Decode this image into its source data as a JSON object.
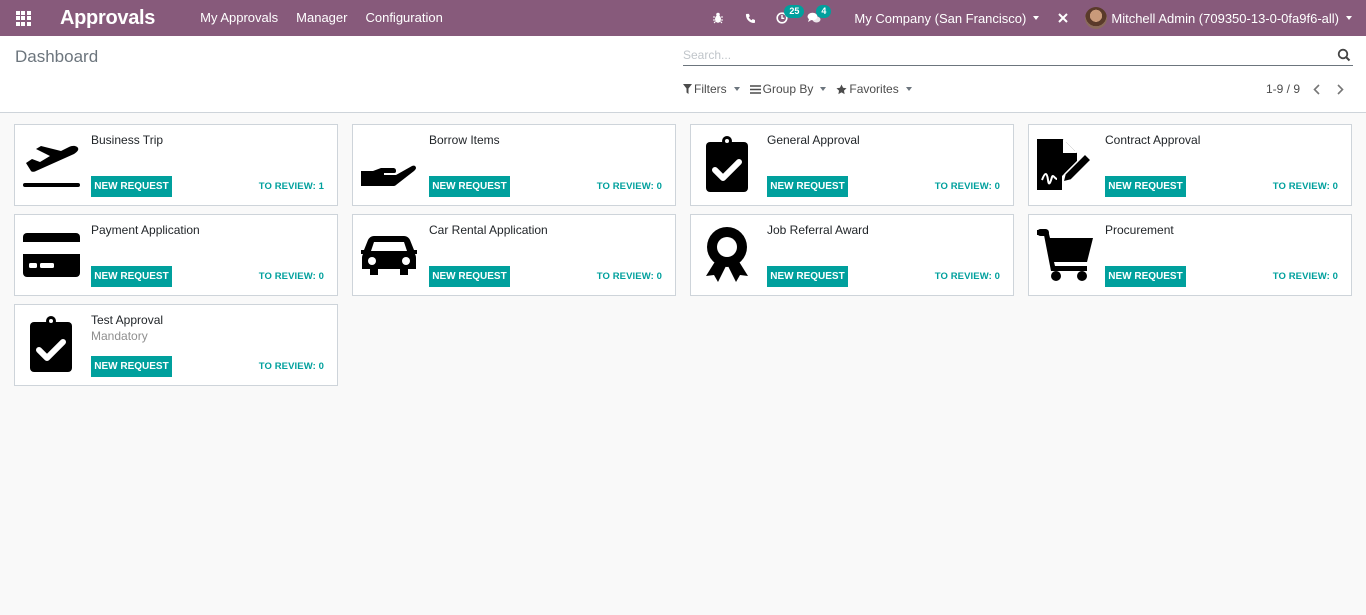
{
  "navbar": {
    "app_title": "Approvals",
    "menu": [
      "My Approvals",
      "Manager",
      "Configuration"
    ],
    "activity_count": "25",
    "message_count": "4",
    "company": "My Company (San Francisco)",
    "user": "Mitchell Admin (709350-13-0-0fa9f6-all)",
    "icons": [
      "apps-icon",
      "bug-icon",
      "phone-icon",
      "clock-icon",
      "chat-icon",
      "tools-icon"
    ],
    "color": "#875a7b"
  },
  "control_panel": {
    "breadcrumb": "Dashboard",
    "search_placeholder": "Search...",
    "filters_label": "Filters",
    "groupby_label": "Group By",
    "favorites_label": "Favorites",
    "pager": "1-9 / 9"
  },
  "accent_color": "#00a09d",
  "cards": [
    {
      "title": "Business Trip",
      "subtitle": "",
      "icon": "plane-departure-icon",
      "button": "NEW REQUEST",
      "review": "TO REVIEW: 1"
    },
    {
      "title": "Borrow Items",
      "subtitle": "",
      "icon": "hand-icon",
      "button": "NEW REQUEST",
      "review": "TO REVIEW: 0"
    },
    {
      "title": "General Approval",
      "subtitle": "",
      "icon": "clipboard-check-icon",
      "button": "NEW REQUEST",
      "review": "TO REVIEW: 0"
    },
    {
      "title": "Contract Approval",
      "subtitle": "",
      "icon": "file-signature-icon",
      "button": "NEW REQUEST",
      "review": "TO REVIEW: 0"
    },
    {
      "title": "Payment Application",
      "subtitle": "",
      "icon": "credit-card-icon",
      "button": "NEW REQUEST",
      "review": "TO REVIEW: 0"
    },
    {
      "title": "Car Rental Application",
      "subtitle": "",
      "icon": "car-icon",
      "button": "NEW REQUEST",
      "review": "TO REVIEW: 0"
    },
    {
      "title": "Job Referral Award",
      "subtitle": "",
      "icon": "award-icon",
      "button": "NEW REQUEST",
      "review": "TO REVIEW: 0"
    },
    {
      "title": "Procurement",
      "subtitle": "",
      "icon": "shopping-cart-icon",
      "button": "NEW REQUEST",
      "review": "TO REVIEW: 0"
    },
    {
      "title": "Test Approval",
      "subtitle": "Mandatory",
      "icon": "clipboard-check-icon",
      "button": "NEW REQUEST",
      "review": "TO REVIEW: 0"
    }
  ]
}
